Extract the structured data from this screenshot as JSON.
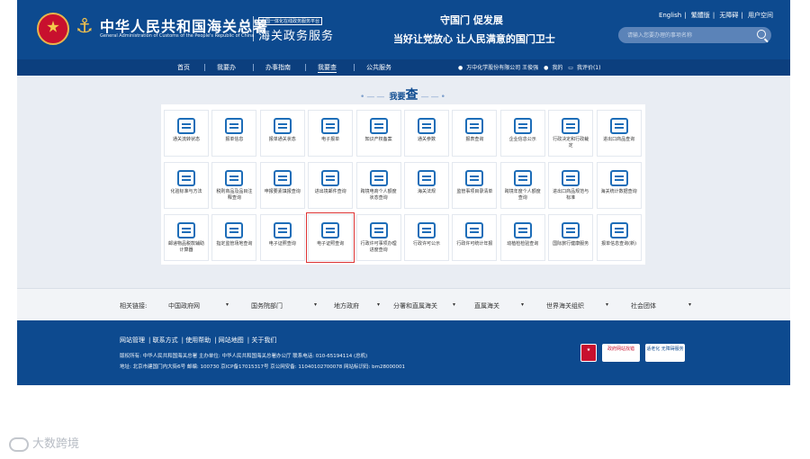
{
  "header": {
    "agency_title": "中华人民共和国海关总署",
    "agency_subtitle": "General Administration of Customs of the People's Republic of China",
    "platform_tag": "全国一体化在线政务服务平台",
    "service_title": "海关政务服务",
    "slogan_line1": "守国门  促发展",
    "slogan_line2": "当好让党放心  让人民满意的国门卫士",
    "top_links": [
      "English",
      "繁體版",
      "无障碍",
      "用户空间"
    ],
    "search_placeholder": "请输入您要办理的事项名称"
  },
  "nav": {
    "items": [
      "首页",
      "我要办",
      "办事指南",
      "我要查",
      "公共服务"
    ],
    "active": "我要查",
    "user": {
      "company": "万中化学股份有限公司 王俊强",
      "mine": "我的",
      "review": "我评价(1)"
    }
  },
  "section": {
    "title_prefix": "我要",
    "title_main": "查"
  },
  "tiles": [
    {
      "label": "通关流转状态",
      "icon": "customs-flow-icon"
    },
    {
      "label": "报单信息",
      "icon": "printer-icon"
    },
    {
      "label": "报单通关状态",
      "icon": "document-status-icon"
    },
    {
      "label": "电子报单",
      "icon": "printer-icon"
    },
    {
      "label": "知识产权备案",
      "icon": "ip-icon"
    },
    {
      "label": "通关参数",
      "icon": "sliders-icon"
    },
    {
      "label": "报表查询",
      "icon": "report-icon"
    },
    {
      "label": "企业信息公示",
      "icon": "chat-icon"
    },
    {
      "label": "行政决定和行政裁定",
      "icon": "gavel-icon"
    },
    {
      "label": "进出口商品查询",
      "icon": "handshake-icon"
    },
    {
      "label": "化验标准与方法",
      "icon": "flask-icon"
    },
    {
      "label": "税则商品及品目注释查询",
      "icon": "tariff-icon"
    },
    {
      "label": "申报要素填报查询",
      "icon": "table-icon"
    },
    {
      "label": "进出境邮件查询",
      "icon": "box-icon"
    },
    {
      "label": "跨境电商个人额度状态查询",
      "icon": "package-icon"
    },
    {
      "label": "海关法规",
      "icon": "law-icon"
    },
    {
      "label": "监管事项目录清单",
      "icon": "list-icon"
    },
    {
      "label": "跨境年度个人额度查询",
      "icon": "person-card-icon"
    },
    {
      "label": "进出口商品规范与标准",
      "icon": "standards-icon"
    },
    {
      "label": "海关统计数据查询",
      "icon": "stats-icon"
    },
    {
      "label": "邮递物品税款辅助计算器",
      "icon": "calculator-icon"
    },
    {
      "label": "指定监管场地查询",
      "icon": "site-icon"
    },
    {
      "label": "电子证照查询",
      "icon": "license-icon"
    },
    {
      "label": "电子证照查询",
      "icon": "license-search-icon"
    },
    {
      "label": "行政许可事项办理进度查询",
      "icon": "progress-icon"
    },
    {
      "label": "行政许可公示",
      "icon": "notice-icon"
    },
    {
      "label": "行政许可统计年报",
      "icon": "calendar-icon"
    },
    {
      "label": "动植检检验查询",
      "icon": "plant-icon"
    },
    {
      "label": "国际旅行健康服务",
      "icon": "health-icon"
    },
    {
      "label": "报单信息查询(新)",
      "icon": "search-doc-icon"
    }
  ],
  "selected_tile_index": 23,
  "related": {
    "label": "相关链接:",
    "items": [
      "中国政府网",
      "国务院部门",
      "地方政府",
      "分署和直属海关",
      "直属海关",
      "世界海关组织",
      "社会团体"
    ]
  },
  "footer": {
    "links": [
      "网站管理",
      "联系方式",
      "使用帮助",
      "网站地图",
      "关于我们"
    ],
    "line1": "版权所有: 中华人民共和国海关总署    主办单位: 中华人民共和国海关总署办公厅    联系电话: 010-65194114 (总机)",
    "line2": "地址: 北京市建国门内大街6号    邮编: 100730    京ICP备17015317号    京公网安备: 11040102700078    网站标识码: bm28000001",
    "badges": [
      "政府网站找错",
      "适老化 无障碍服务"
    ]
  },
  "watermark": "大数跨境",
  "colors": {
    "primary": "#0d4a8f",
    "nav": "#0c3f7e",
    "accent": "#1d6db8",
    "highlight": "#d33333"
  }
}
